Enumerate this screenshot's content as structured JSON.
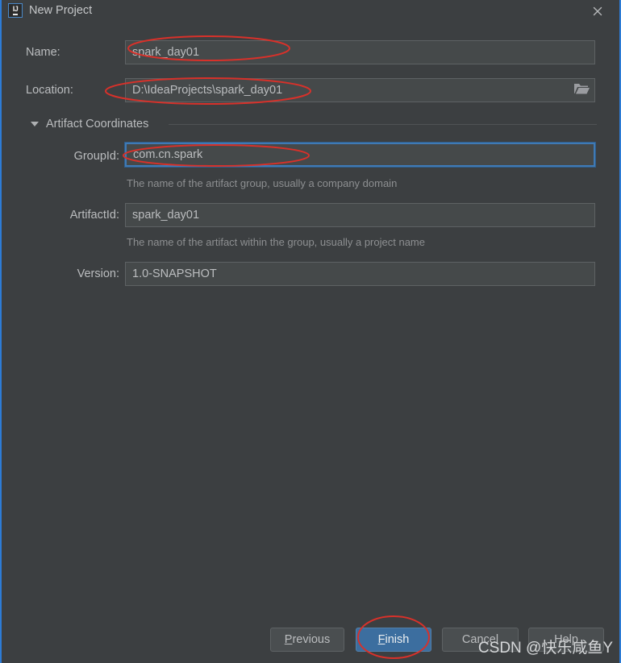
{
  "window": {
    "title": "New Project",
    "app_icon": "intellij-idea-icon",
    "close_icon": "close-icon",
    "accent_border_color": "#2d7cd6",
    "background_color": "#3c3f41"
  },
  "form": {
    "name_label": "Name:",
    "name_value": "spark_day01",
    "location_label": "Location:",
    "location_value": "D:\\IdeaProjects\\spark_day01",
    "browse_icon": "folder-open-icon"
  },
  "section": {
    "title": "Artifact Coordinates",
    "collapse_icon": "chevron-down-icon",
    "expanded": true,
    "fields": [
      {
        "label": "GroupId:",
        "value": "com.cn.spark",
        "hint": "The name of the artifact group, usually a company domain",
        "focused": true
      },
      {
        "label": "ArtifactId:",
        "value": "spark_day01",
        "hint": "The name of the artifact within the group, usually a project name",
        "focused": false
      },
      {
        "label": "Version:",
        "value": "1.0-SNAPSHOT",
        "hint": "",
        "focused": false
      }
    ]
  },
  "buttons": {
    "previous": {
      "label": "Previous",
      "mnemonic": "P",
      "primary": false
    },
    "finish": {
      "label": "Finish",
      "mnemonic": "F",
      "primary": true
    },
    "cancel": {
      "label": "Cancel",
      "mnemonic": "",
      "primary": false
    },
    "help": {
      "label": "Help",
      "mnemonic": "",
      "primary": false
    }
  },
  "annotations": {
    "color": "#d8312a",
    "highlight_targets": [
      "name_value",
      "location_value",
      "groupid_value",
      "finish_button"
    ]
  },
  "watermark": {
    "text": "CSDN @快乐咸鱼Y"
  }
}
